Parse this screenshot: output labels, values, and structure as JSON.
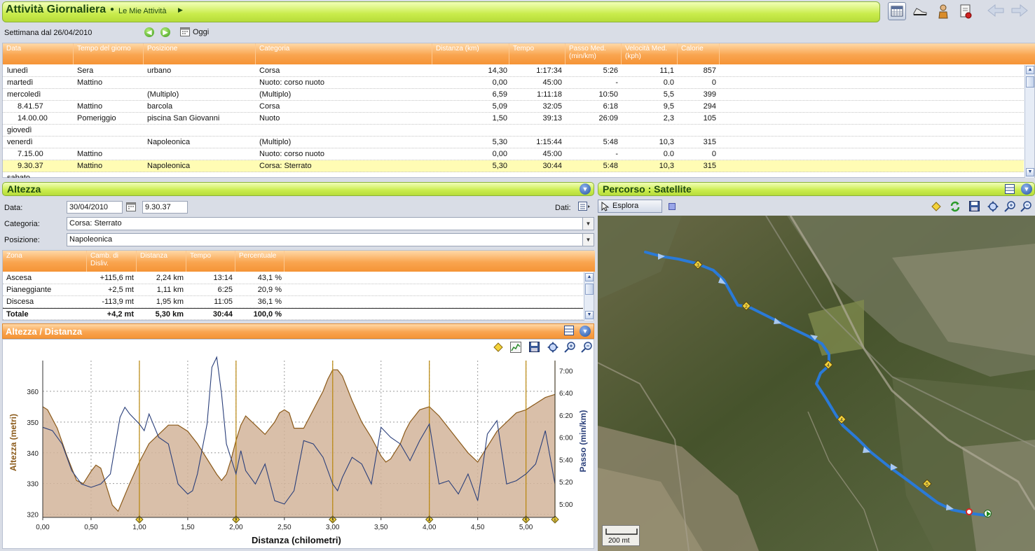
{
  "header": {
    "title": "Attività Giornaliera",
    "crumb": "Le Mie Attività",
    "icons": [
      "calendar-view-icon",
      "shoe-icon",
      "athlete-icon",
      "report-icon",
      "back-arrow-icon",
      "forward-arrow-icon"
    ]
  },
  "week": {
    "label": "Settimana dal 26/04/2010",
    "today": "Oggi"
  },
  "table": {
    "columns": [
      "Data",
      "Tempo del giorno",
      "Posizione",
      "Categoria",
      "Distanza (km)",
      "Tempo",
      "Passo Med. (min/km)",
      "Velocità Med. (kph)",
      "Calorie"
    ],
    "rows": [
      {
        "data": "lunedì",
        "tempo_giorno": "Sera",
        "posizione": "urbano",
        "categoria": "Corsa",
        "distanza": "14,30",
        "tempo": "1:17:34",
        "passo": "5:26",
        "velocita": "11,1",
        "calorie": "857"
      },
      {
        "data": "martedì",
        "tempo_giorno": "Mattino",
        "posizione": "",
        "categoria": "Nuoto: corso nuoto",
        "distanza": "0,00",
        "tempo": "45:00",
        "passo": "-",
        "velocita": "0.0",
        "calorie": "0"
      },
      {
        "data": "mercoledì",
        "tempo_giorno": "",
        "posizione": "(Multiplo)",
        "categoria": "(Multiplo)",
        "distanza": "6,59",
        "tempo": "1:11:18",
        "passo": "10:50",
        "velocita": "5,5",
        "calorie": "399"
      },
      {
        "data": "8.41.57",
        "tempo_giorno": "Mattino",
        "posizione": "barcola",
        "categoria": "Corsa",
        "distanza": "5,09",
        "tempo": "32:05",
        "passo": "6:18",
        "velocita": "9,5",
        "calorie": "294"
      },
      {
        "data": "14.00.00",
        "tempo_giorno": "Pomeriggio",
        "posizione": "piscina San Giovanni",
        "categoria": "Nuoto",
        "distanza": "1,50",
        "tempo": "39:13",
        "passo": "26:09",
        "velocita": "2,3",
        "calorie": "105"
      },
      {
        "data": "giovedì",
        "tempo_giorno": "",
        "posizione": "",
        "categoria": "",
        "distanza": "",
        "tempo": "",
        "passo": "",
        "velocita": "",
        "calorie": ""
      },
      {
        "data": "venerdì",
        "tempo_giorno": "",
        "posizione": "Napoleonica",
        "categoria": "(Multiplo)",
        "distanza": "5,30",
        "tempo": "1:15:44",
        "passo": "5:48",
        "velocita": "10,3",
        "calorie": "315"
      },
      {
        "data": "7.15.00",
        "tempo_giorno": "Mattino",
        "posizione": "",
        "categoria": "Nuoto: corso nuoto",
        "distanza": "0,00",
        "tempo": "45:00",
        "passo": "-",
        "velocita": "0.0",
        "calorie": "0"
      },
      {
        "data": "9.30.37",
        "tempo_giorno": "Mattino",
        "posizione": "Napoleonica",
        "categoria": "Corsa: Sterrato",
        "distanza": "5,30",
        "tempo": "30:44",
        "passo": "5:48",
        "velocita": "10,3",
        "calorie": "315"
      },
      {
        "data": "sabato",
        "tempo_giorno": "",
        "posizione": "",
        "categoria": "",
        "distanza": "",
        "tempo": "",
        "passo": "",
        "velocita": "",
        "calorie": ""
      }
    ],
    "selected_row": 8,
    "selected_color": "#fffcb4"
  },
  "altezza": {
    "title": "Altezza",
    "data_label": "Data:",
    "date": "30/04/2010",
    "time": "9.30.37",
    "dati_label": "Dati:",
    "categoria_label": "Categoria:",
    "categoria": "Corsa: Sterrato",
    "posizione_label": "Posizione:",
    "posizione": "Napoleonica"
  },
  "zones": {
    "columns": [
      "Zona",
      "Camb. di Disliv.",
      "Distanza",
      "Tempo",
      "Percentuale"
    ],
    "rows": [
      {
        "zona": "Ascesa",
        "disliv": "+115,6 mt",
        "dist": "2,24 km",
        "tempo": "13:14",
        "perc": "43,1 %"
      },
      {
        "zona": "Pianeggiante",
        "disliv": "+2,5 mt",
        "dist": "1,11 km",
        "tempo": "6:25",
        "perc": "20,9 %"
      },
      {
        "zona": "Discesa",
        "disliv": "-113,9 mt",
        "dist": "1,95 km",
        "tempo": "11:05",
        "perc": "36,1 %"
      }
    ],
    "total": {
      "zona": "Totale",
      "disliv": "+4,2 mt",
      "dist": "5,30 km",
      "tempo": "30:44",
      "perc": "100,0 %"
    }
  },
  "elev_chart": {
    "title": "Altezza / Distanza",
    "xlabel": "Distanza (chilometri)",
    "ylabel_left": "Altezza (metri)",
    "ylabel_right": "Passo (min/km)",
    "elev_color": "#8b5a1a",
    "pace_color": "#2a3f7a"
  },
  "chart_data": {
    "type": "area",
    "x_ticks": [
      "0,00",
      "0,50",
      "1,00",
      "1,50",
      "2,00",
      "2,50",
      "3,00",
      "3,50",
      "4,00",
      "4,50",
      "5,00"
    ],
    "y_left_ticks": [
      "320",
      "330",
      "340",
      "350",
      "360"
    ],
    "y_right_ticks": [
      "5:00",
      "5:20",
      "5:40",
      "6:00",
      "6:20",
      "6:40",
      "7:00"
    ],
    "xlim": [
      0,
      5.3
    ],
    "ylim_left": [
      319,
      370
    ],
    "ylim_right_min_per_km": [
      4.8,
      7.15
    ],
    "km_markers": [
      {
        "x": 1.0,
        "label": "1"
      },
      {
        "x": 2.0,
        "label": "2"
      },
      {
        "x": 3.0,
        "label": "3"
      },
      {
        "x": 4.0,
        "label": "4"
      },
      {
        "x": 5.0,
        "label": "5"
      },
      {
        "x": 5.3,
        "label": "6"
      }
    ],
    "series": [
      {
        "name": "Altezza",
        "x": [
          0,
          0.05,
          0.15,
          0.25,
          0.35,
          0.42,
          0.5,
          0.55,
          0.6,
          0.65,
          0.72,
          0.78,
          0.82,
          0.9,
          1.0,
          1.1,
          1.2,
          1.3,
          1.4,
          1.5,
          1.6,
          1.7,
          1.8,
          1.85,
          1.9,
          1.95,
          2.0,
          2.05,
          2.1,
          2.2,
          2.3,
          2.4,
          2.45,
          2.5,
          2.55,
          2.6,
          2.7,
          2.8,
          2.9,
          2.95,
          3.0,
          3.05,
          3.1,
          3.2,
          3.3,
          3.4,
          3.5,
          3.55,
          3.6,
          3.7,
          3.75,
          3.8,
          3.85,
          3.9,
          4.0,
          4.1,
          4.2,
          4.3,
          4.4,
          4.5,
          4.6,
          4.7,
          4.8,
          4.9,
          5.0,
          5.1,
          5.2,
          5.3
        ],
        "y": [
          355,
          354,
          348,
          339,
          331,
          330,
          334,
          336,
          335,
          330,
          323,
          321,
          324,
          330,
          337,
          343,
          346,
          349,
          349,
          347,
          343,
          338,
          333,
          331,
          333,
          338,
          344,
          349,
          352,
          349,
          346,
          350,
          353,
          354,
          353,
          348,
          348,
          354,
          360,
          364,
          367,
          367,
          365,
          357,
          350,
          345,
          339,
          337,
          338,
          343,
          347,
          350,
          352,
          354,
          355,
          352,
          348,
          344,
          340,
          337,
          342,
          347,
          350,
          353,
          354,
          356,
          358,
          359
        ]
      },
      {
        "name": "Passo",
        "x": [
          0,
          0.1,
          0.2,
          0.3,
          0.4,
          0.5,
          0.6,
          0.7,
          0.8,
          0.85,
          0.9,
          1.0,
          1.05,
          1.1,
          1.2,
          1.3,
          1.4,
          1.5,
          1.55,
          1.6,
          1.7,
          1.75,
          1.8,
          1.85,
          1.9,
          2.0,
          2.05,
          2.1,
          2.2,
          2.3,
          2.4,
          2.5,
          2.6,
          2.7,
          2.8,
          2.9,
          3.0,
          3.05,
          3.1,
          3.2,
          3.3,
          3.4,
          3.5,
          3.6,
          3.7,
          3.8,
          3.9,
          4.0,
          4.1,
          4.2,
          4.3,
          4.4,
          4.5,
          4.6,
          4.7,
          4.8,
          4.9,
          5.0,
          5.1,
          5.2,
          5.3
        ],
        "y": [
          6.15,
          6.1,
          5.9,
          5.5,
          5.3,
          5.25,
          5.3,
          5.45,
          6.3,
          6.45,
          6.35,
          6.2,
          6.1,
          6.35,
          6.0,
          5.9,
          5.3,
          5.15,
          5.2,
          5.45,
          6.2,
          7.05,
          7.2,
          6.65,
          5.9,
          5.45,
          5.8,
          5.5,
          5.3,
          5.6,
          5.05,
          5.0,
          5.2,
          5.95,
          5.9,
          5.7,
          5.3,
          5.2,
          5.4,
          5.7,
          5.6,
          5.3,
          6.15,
          6.0,
          5.9,
          5.65,
          5.95,
          6.2,
          5.3,
          5.35,
          5.15,
          5.45,
          5.05,
          6.05,
          6.25,
          5.3,
          5.35,
          5.45,
          5.6,
          6.1,
          5.3
        ]
      }
    ]
  },
  "route": {
    "title": "Percorso  : Satellite",
    "tool": "Esplora",
    "scale": "200 mt",
    "markers": [
      "1",
      "2",
      "3",
      "4",
      "5"
    ]
  }
}
